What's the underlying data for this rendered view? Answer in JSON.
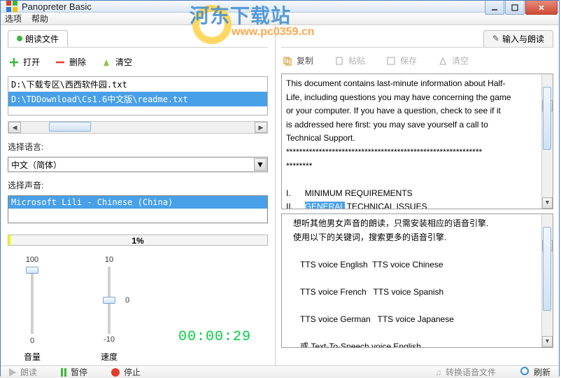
{
  "window": {
    "title": "Panopreter Basic"
  },
  "menu": {
    "options": "选项",
    "help": "帮助"
  },
  "watermark": {
    "line1": "河东下载站",
    "line2": "www.pc0359.cn"
  },
  "left": {
    "tab_read": "朗读文件",
    "tab_input": "输入与朗读",
    "toolbar": {
      "open": "打开",
      "delete": "删除",
      "clear": "清空"
    },
    "files": [
      "D:\\下载专区\\西西软件园.txt",
      "D:\\TDDownload\\Cs1.6中文版\\readme.txt"
    ],
    "lang_label": "选择语言:",
    "lang_value": "中文（简体）",
    "voice_label": "选择声音:",
    "voice_value": "Microsoft Lili - Chinese (China)",
    "progress_pct": "1%",
    "slider_vol": {
      "top": "100",
      "bot": "0",
      "label": "音量"
    },
    "slider_spd": {
      "top": "10",
      "mid": "0",
      "bot": "-10",
      "label": "速度"
    },
    "timer": "00:00:29"
  },
  "right": {
    "toolbar": {
      "copy": "复制",
      "paste": "粘贴",
      "save": "保存",
      "clear": "清空"
    },
    "doc_text_pre": "This document contains last-minute information about Half-\nLife, including questions you may have concerning the game\nor your computer. If you have a question, check to see if it\nis addressed here first: you may save yourself a call to\nTechnical Support.\n************************************************************\n********\n\nI.      MINIMUM REQUIREMENTS\nII.     ",
    "doc_hl": "GENERAL",
    "doc_text_post": " TECHNICAL ISSUES\nIII.    GENERAL GAME ISSUES",
    "hint": "   想听其他男女声音的朗读，只需安装相应的语音引擎.\n   使用以下的关键词，搜索更多的语音引擎.\n\n      TTS voice English  TTS voice Chinese\n\n      TTS voice French   TTS voice Spanish\n\n      TTS voice German   TTS voice Japanese\n\n      或 Text-To-Speech voice English"
  },
  "status": {
    "read": "朗读",
    "pause": "暂停",
    "stop": "停止",
    "convert": "转换语音文件",
    "refresh": "刷新"
  }
}
